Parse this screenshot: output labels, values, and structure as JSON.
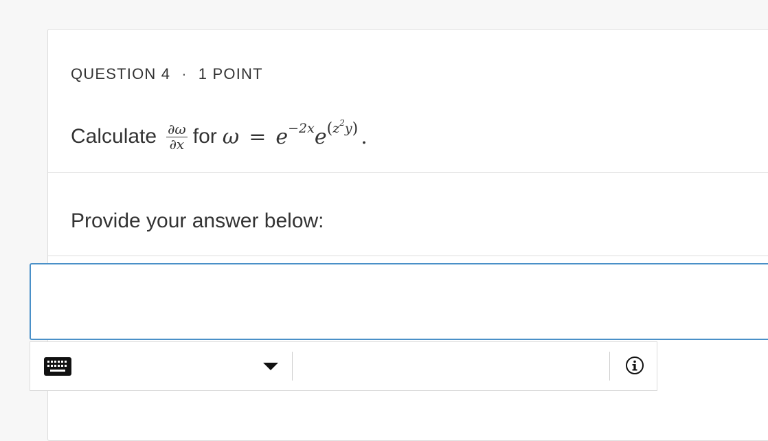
{
  "question": {
    "number_label": "QUESTION 4",
    "separator": "·",
    "points_label": "1 POINT",
    "prompt_prefix": "Calculate",
    "math": {
      "fraction_numerator": "∂ω",
      "fraction_denominator": "∂x",
      "for_word": "for",
      "omega": "ω",
      "equals": "=",
      "base1": "e",
      "exp1": "−2x",
      "base2": "e",
      "exp2_open": "(",
      "exp2_var": "z",
      "exp2_power": "2",
      "exp2_var2": "y",
      "exp2_close": ")",
      "period": "."
    }
  },
  "answer": {
    "prompt": "Provide your answer below:",
    "value": "",
    "placeholder": ""
  },
  "toolbar": {
    "icons": [
      "keyboard-icon",
      "chevron-down-icon",
      "info-icon"
    ]
  },
  "colors": {
    "accent_border": "#4a90c8",
    "card_border": "#dcdcdc",
    "background": "#f7f7f7"
  }
}
